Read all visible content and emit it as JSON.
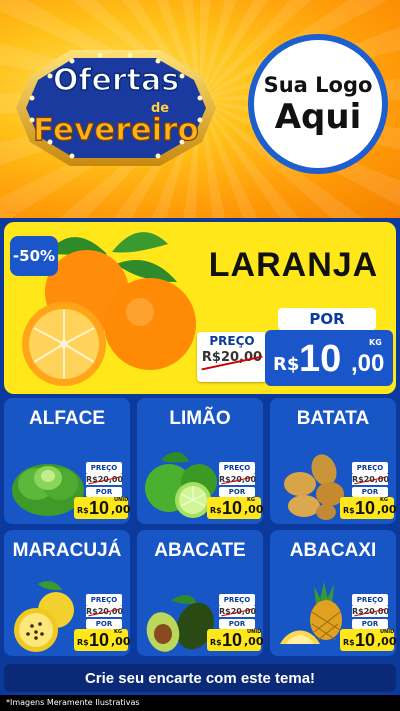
{
  "header": {
    "badge_line1": "Ofertas",
    "badge_line2": "de",
    "badge_line3": "Fevereiro",
    "logo_line1": "Sua Logo",
    "logo_line2": "Aqui"
  },
  "feature": {
    "discount": "-50%",
    "title": "LARANJA",
    "preco_label": "PREÇO",
    "old_price": "R$20,00",
    "por_label": "POR",
    "currency": "R$",
    "price_int": "10",
    "price_dec": ",00",
    "unit": "KG"
  },
  "products": [
    {
      "name": "ALFACE",
      "preco_label": "PREÇO",
      "old": "R$20,00",
      "por_label": "POR",
      "currency": "R$",
      "int": "10",
      "dec": ",00",
      "unit": "UNID"
    },
    {
      "name": "LIMÃO",
      "preco_label": "PREÇO",
      "old": "R$20,00",
      "por_label": "POR",
      "currency": "R$",
      "int": "10",
      "dec": ",00",
      "unit": "KG"
    },
    {
      "name": "BATATA",
      "preco_label": "PREÇO",
      "old": "R$20,00",
      "por_label": "POR",
      "currency": "R$",
      "int": "10",
      "dec": ",00",
      "unit": "KG"
    },
    {
      "name": "MARACUJÁ",
      "preco_label": "PREÇO",
      "old": "R$20,00",
      "por_label": "POR",
      "currency": "R$",
      "int": "10",
      "dec": ",00",
      "unit": "KG"
    },
    {
      "name": "ABACATE",
      "preco_label": "PREÇO",
      "old": "R$20,00",
      "por_label": "POR",
      "currency": "R$",
      "int": "10",
      "dec": ",00",
      "unit": "UNID"
    },
    {
      "name": "ABACAXI",
      "preco_label": "PREÇO",
      "old": "R$20,00",
      "por_label": "POR",
      "currency": "R$",
      "int": "10",
      "dec": ",00",
      "unit": "UNID"
    }
  ],
  "cta": "Crie seu encarte com este tema!",
  "footer": "*Imagens Meramente Ilustrativas",
  "colors": {
    "primary_blue": "#1856c5",
    "yellow": "#ffe71a",
    "orange": "#ff9a08"
  }
}
